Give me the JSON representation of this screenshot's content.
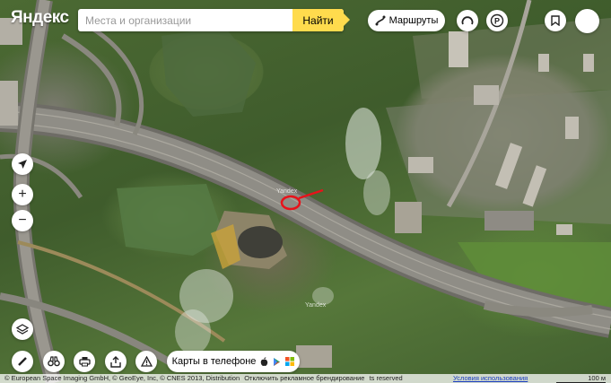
{
  "header": {
    "logo_text": "Яндекс",
    "search_placeholder": "Места и организации",
    "search_button_label": "Найти",
    "routes_label": "Маршруты"
  },
  "map": {
    "watermarks": [
      "Yandex",
      "Yandex"
    ],
    "marker_color": "#e8121a"
  },
  "controls": {
    "zoom_in": "+",
    "zoom_out": "−"
  },
  "bottom": {
    "phone_label": "Карты в телефоне"
  },
  "footer": {
    "copyright": "© European Space Imaging GmbH, © GeoEye, Inc, © CNES 2013, Distribution",
    "ad_text": "Отключить рекламное брендирование",
    "rights": "ts reserved",
    "terms_link": "Условия использования",
    "scale": "100 м"
  },
  "colors": {
    "accent": "#ffdb4d",
    "link": "#1a3dc1"
  }
}
